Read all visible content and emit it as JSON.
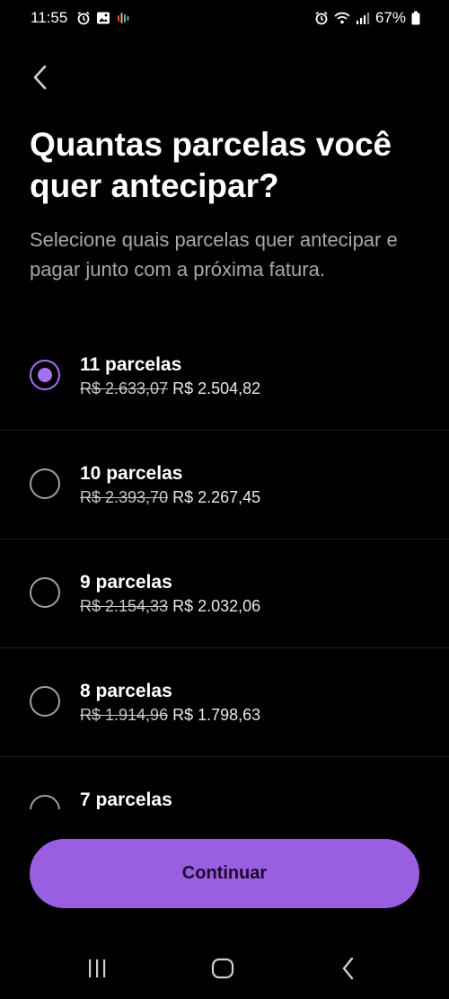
{
  "status_bar": {
    "time": "11:55",
    "battery": "67%",
    "left_icons": [
      "alarm-icon",
      "image-icon",
      "dots-icon"
    ],
    "right_icons": [
      "alarm-icon",
      "wifi-icon",
      "signal-icon",
      "battery-icon"
    ]
  },
  "header": {
    "back_icon": "chevron-left-icon",
    "title": "Quantas parcelas você quer antecipar?",
    "subtitle": "Selecione quais parcelas quer antecipar e pagar junto com a próxima fatura."
  },
  "options": [
    {
      "label": "11 parcelas",
      "old_price": "R$ 2.633,07",
      "new_price": "R$ 2.504,82",
      "selected": true
    },
    {
      "label": "10 parcelas",
      "old_price": "R$ 2.393,70",
      "new_price": "R$ 2.267,45",
      "selected": false
    },
    {
      "label": "9 parcelas",
      "old_price": "R$ 2.154,33",
      "new_price": "R$ 2.032,06",
      "selected": false
    },
    {
      "label": "8 parcelas",
      "old_price": "R$ 1.914,96",
      "new_price": "R$ 1.798,63",
      "selected": false
    },
    {
      "label": "7 parcelas",
      "old_price": "",
      "new_price": "",
      "selected": false
    }
  ],
  "continue_button": {
    "label": "Continuar"
  },
  "nav_bar": {
    "icons": [
      "recent-apps-icon",
      "home-icon",
      "back-icon"
    ]
  },
  "colors": {
    "accent": "#9a5ee3",
    "radio_selected": "#a571f0",
    "background": "#000000",
    "subtitle": "#a8a8a8"
  }
}
